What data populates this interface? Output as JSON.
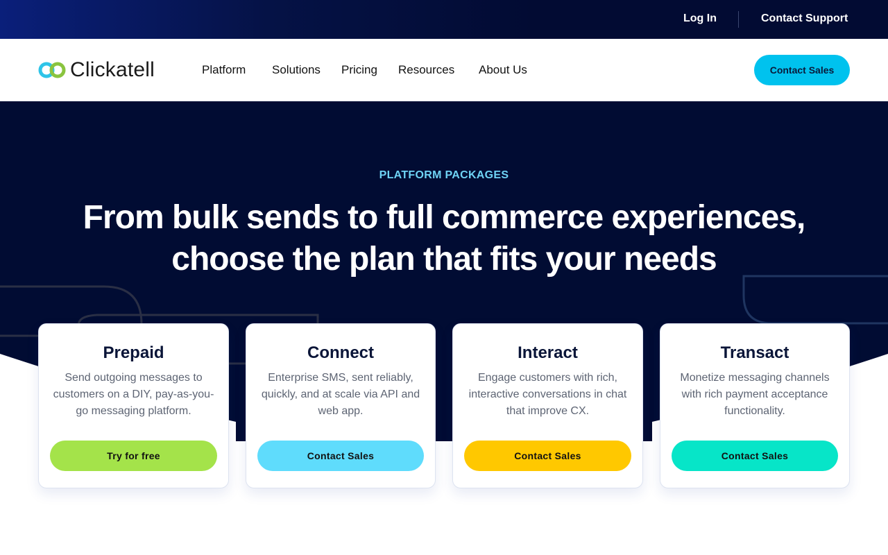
{
  "topbar": {
    "login": "Log In",
    "support": "Contact Support"
  },
  "nav": {
    "logo": "Clickatell",
    "items": [
      "Platform",
      "Solutions",
      "Pricing",
      "Resources",
      "About Us"
    ],
    "cta": "Contact Sales"
  },
  "hero": {
    "eyebrow": "PLATFORM PACKAGES",
    "headline": "From bulk sends to full commerce experiences, choose the plan that fits your needs"
  },
  "cards": [
    {
      "title": "Prepaid",
      "desc": "Send outgoing messages to customers on a DIY, pay-as-you-go messaging platform.",
      "button": "Try for free",
      "color": "#a4e34a"
    },
    {
      "title": "Connect",
      "desc": "Enterprise SMS, sent reliably, quickly, and at scale via API and web app.",
      "button": "Contact Sales",
      "color": "#5fdcfc"
    },
    {
      "title": "Interact",
      "desc": "Engage customers with rich, interactive conversations in chat that improve CX.",
      "button": "Contact Sales",
      "color": "#ffc800"
    },
    {
      "title": "Transact",
      "desc": "Monetize messaging channels with rich payment acceptance functionality.",
      "button": "Contact Sales",
      "color": "#07e5c8"
    }
  ],
  "colors": {
    "hero_bg": "#010c33",
    "accent": "#00c2ee",
    "eyebrow": "#6fd3f5"
  }
}
